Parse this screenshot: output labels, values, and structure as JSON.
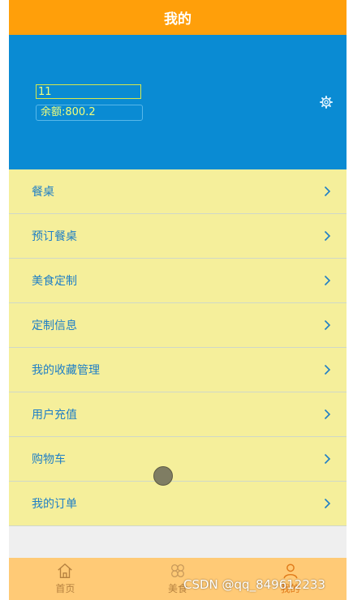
{
  "header": {
    "title": "我的"
  },
  "profile": {
    "username": "11",
    "balance_label": "余额:",
    "balance_value": "800.2",
    "settings_icon": "gear-icon"
  },
  "menu": {
    "items": [
      {
        "label": "餐桌"
      },
      {
        "label": "预订餐桌"
      },
      {
        "label": "美食定制"
      },
      {
        "label": "定制信息"
      },
      {
        "label": "我的收藏管理"
      },
      {
        "label": "用户充值"
      },
      {
        "label": "购物车"
      },
      {
        "label": "我的订单"
      }
    ]
  },
  "tabbar": {
    "tabs": [
      {
        "label": "首页",
        "icon": "home-icon"
      },
      {
        "label": "美食",
        "icon": "clover-icon"
      },
      {
        "label": "我的",
        "icon": "user-icon"
      }
    ]
  },
  "watermark": "CSDN @qq_849612233",
  "colors": {
    "header": "#ff9f0a",
    "profile": "#0a8bd3",
    "menu": "#f5ef9b",
    "menu_text": "#1f7fc6",
    "tabbar": "#ffca76"
  }
}
